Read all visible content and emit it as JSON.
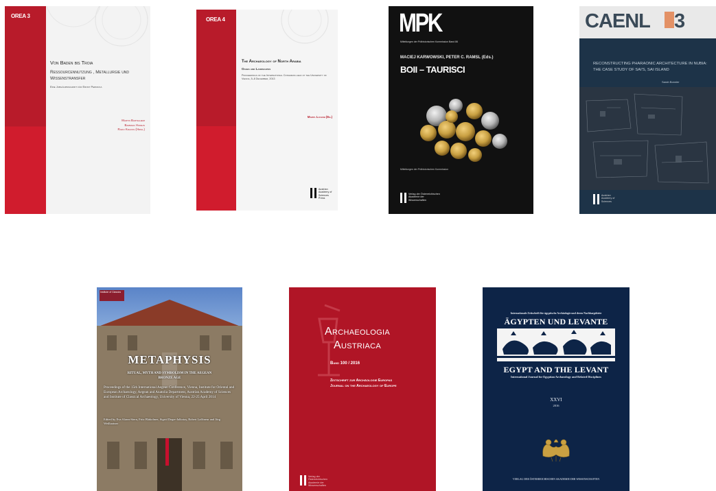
{
  "covers": [
    {
      "series": "OREA 3",
      "title": "Von Baden bis Troia",
      "subtitle": "Ressourcennutzung , Metallurgie und Wissenstransfer",
      "dedication": "Eine Jubiläumsschrift für Ernst Pernicka",
      "editors": [
        "Martin Bartelheim",
        "Barbara Horejs",
        "Raiko Krauss (Hrsg.)"
      ]
    },
    {
      "series": "OREA 4",
      "title": "The Archaeology of North Arabia",
      "subtitle": "Oases and Landscapes",
      "proceedings": "Proceedings of the International Congress held at the University of Vienna, 5–8 December, 2013",
      "editor": "Marta Luciani (Ed.)",
      "publisher": "Austrian Academy of Sciences Press"
    },
    {
      "series": "MPK",
      "series_sub": "Mitteilungen der Prähistorischen Kommission Band 86",
      "authors": "MACIEJ KARWOWSKI, PETER C. RAMSL (Eds.)",
      "title": "BOII – TAURISCI",
      "note": "Mitteilungen der Prähistorischen Kommission",
      "publisher": "Verlag der Österreichischen Akademie der Wissenschaften"
    },
    {
      "series": "CAENL",
      "series_mark": "3",
      "title": "Reconstructing Pharaonic Architecture in Nubia: The Case Study of Sai's, Sai Island",
      "author": "Sarah Bonnier",
      "publisher": "Austrian Academy of Sciences"
    },
    {
      "label_top": "Institute of Classics",
      "title": "METAPHYSIS",
      "subtitle": "Ritual, Myth and Symbolism in the Aegean Bronze Age",
      "body": "Proceedings of the 15th International Aegean Conference, Vienna, Institute for Oriental and European Archaeology, Aegean and Anatolia Department, Austrian Academy of Sciences and Institute of Classical Archaeology, University of Vienna, 22-25 April 2014",
      "editors": "Edited by Eva Alram-Stern, Fritz Blakolmer, Sigrid Deger-Jalkotzy, Robert Laffineur and Jörg Weilhartner"
    },
    {
      "title_line1": "Archaeologia",
      "title_line2": "Austriaca",
      "volume": "Band 100 / 2016",
      "line1": "Zeitschrift zur Archäologie Europas",
      "line2": "Journal on the Archaeology of Europe",
      "publisher": "Verlag der Österreichischen Akademie der Wissenschaften"
    },
    {
      "top_line": "Internationale Zeitschrift für ägyptische Archäologie und deren Nachbargebiete",
      "title_de": "ÄGYPTEN UND LEVANTE",
      "title_en": "EGYPT AND THE LEVANT",
      "sub_en": "International Journal for Egyptian Archaeology and Related Disciplines",
      "volume": "XXVI",
      "year": "2016",
      "publisher": "VERLAG DER ÖSTERREICHISCHEN AKADEMIE DER WISSENSCHAFTEN"
    }
  ],
  "colors": {
    "orea_red": "#b81b2a",
    "orea_red_light": "#cf1f2e",
    "mpk_black": "#111111",
    "caenl_navy": "#1d3348",
    "aa_red": "#b01526",
    "egypt_navy": "#0d2447",
    "gold": "#c9a042"
  }
}
